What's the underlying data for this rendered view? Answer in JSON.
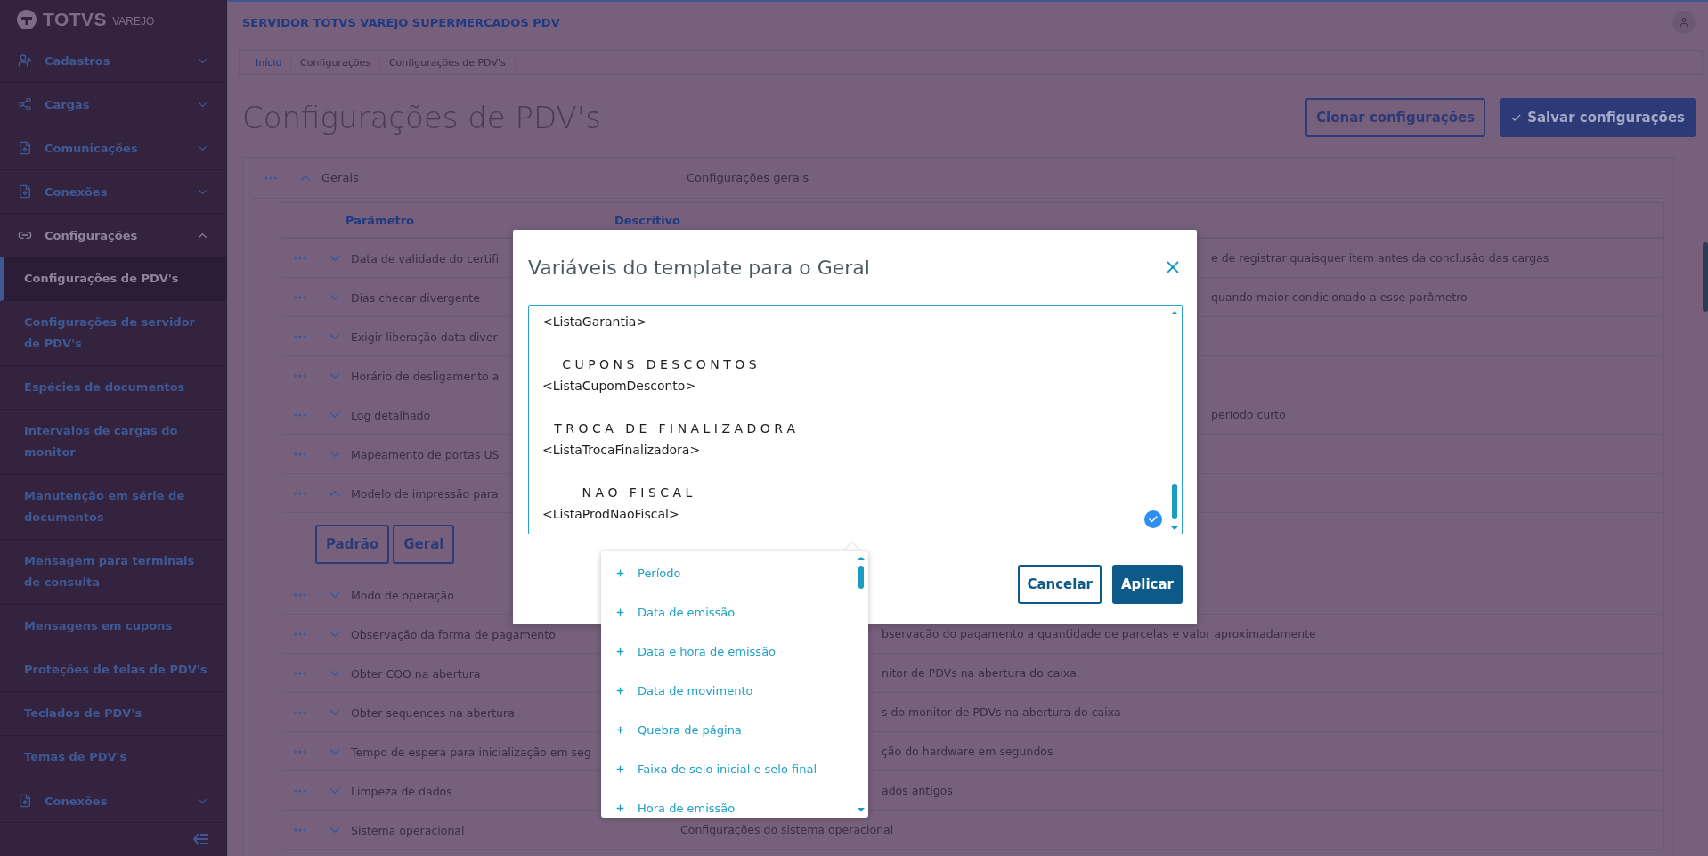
{
  "app": {
    "logo": "TOTVS",
    "logo_sub": "VAREJO",
    "server_title": "SERVIDOR TOTVS VAREJO SUPERMERCADOS PDV"
  },
  "sidebar": {
    "items": [
      {
        "label": "Cadastros",
        "kind": "group",
        "expanded": false
      },
      {
        "label": "Cargas",
        "kind": "group",
        "expanded": false
      },
      {
        "label": "Comunicações",
        "kind": "group",
        "expanded": false
      },
      {
        "label": "Conexões",
        "kind": "group",
        "expanded": false
      },
      {
        "label": "Configurações",
        "kind": "group",
        "expanded": true
      },
      {
        "label": "Configurações de PDV's",
        "kind": "link",
        "selected": true
      },
      {
        "label": "Configurações de servidor de PDV's",
        "kind": "link",
        "selected": false
      },
      {
        "label": "Espécies de documentos",
        "kind": "link",
        "selected": false
      },
      {
        "label": "Intervalos de cargas do monitor",
        "kind": "link",
        "selected": false
      },
      {
        "label": "Manutenção em série de documentos",
        "kind": "link",
        "selected": false
      },
      {
        "label": "Mensagem para terminais de consulta",
        "kind": "link",
        "selected": false
      },
      {
        "label": "Mensagens em cupons",
        "kind": "link",
        "selected": false
      },
      {
        "label": "Proteções de telas de PDV's",
        "kind": "link",
        "selected": false
      },
      {
        "label": "Teclados de PDV's",
        "kind": "link",
        "selected": false
      },
      {
        "label": "Temas de PDV's",
        "kind": "link",
        "selected": false
      },
      {
        "label": "Conexões",
        "kind": "group",
        "expanded": false
      }
    ]
  },
  "breadcrumb": [
    {
      "label": "Início",
      "kind": "link"
    },
    {
      "label": "Configurações",
      "kind": "text"
    },
    {
      "label": "Configurações de PDV's",
      "kind": "text"
    }
  ],
  "page_title": "Configurações de PDV's",
  "actions": [
    {
      "label": "Clonar configurações",
      "kind": "outline"
    },
    {
      "label": "Salvar configurações",
      "kind": "primary"
    }
  ],
  "section": {
    "label": "Gerais",
    "description": "Configurações gerais",
    "expanded": true
  },
  "table": {
    "columns": [
      "Parâmetro",
      "Descritivo"
    ],
    "rows": [
      {
        "parameter": "Data de validade do certifi",
        "description": {
          "text": "e de registrar quaisquer item antes da conclusão das cargas",
          "kind": "after_dialog"
        },
        "expanded": false
      },
      {
        "parameter": "Dias checar divergente",
        "description": {
          "text": "quando maior condicionado a esse parâmetro",
          "kind": "after_dialog"
        },
        "expanded": false
      },
      {
        "parameter": "Exigir liberação data diver",
        "expanded": false
      },
      {
        "parameter": "Horário de desligamento a",
        "expanded": false
      },
      {
        "parameter": "Log detalhado",
        "description": {
          "text": "período curto",
          "kind": "after_dialog"
        },
        "expanded": false
      },
      {
        "parameter": "Mapeamento de portas US",
        "expanded": false
      },
      {
        "parameter": "Modelo de impressão para",
        "expanded": true,
        "templates": [
          "Padrão",
          "Geral"
        ]
      },
      {
        "parameter": "Modo de operação",
        "expanded": false
      },
      {
        "parameter": "Observação da forma de pagamento",
        "description": {
          "text": "bservação do pagamento a quantidade de parcelas e valor aproximadamente",
          "kind": "after_menu"
        },
        "expanded": false
      },
      {
        "parameter": "Obter COO na abertura",
        "description": {
          "text": "nitor de PDVs na abertura do caixa.",
          "kind": "after_menu"
        },
        "expanded": false
      },
      {
        "parameter": "Obter sequences na abertura",
        "description": {
          "text": "s do monitor de PDVs na abertura do caixa",
          "kind": "after_menu"
        },
        "expanded": false
      },
      {
        "parameter": "Tempo de espera para inicialização em seg",
        "description": {
          "text": "ção do hardware em segundos",
          "kind": "after_menu"
        },
        "expanded": false
      },
      {
        "parameter": "Limpeza de dados",
        "description": {
          "text": "ados antigos",
          "kind": "after_menu"
        },
        "expanded": false
      },
      {
        "parameter": "Sistema operacional",
        "description": {
          "text": "Configurações do sistema operacional",
          "kind": "full"
        },
        "expanded": false
      }
    ]
  },
  "dialog": {
    "title": "Variáveis do template para o Geral",
    "template_value": "<ListaGarantia>\n\n     C U P O N S   D E S C O N T O S\n<ListaCupomDesconto>\n\n   T R O C A   D E   F I N A L I Z A D O R A\n<ListaTrocaFinalizadora>\n\n          N A O   F I S C A L\n<ListaProdNaoFiscal>",
    "buttons": [
      {
        "label": "Cancelar",
        "kind": "outline"
      },
      {
        "label": "Aplicar",
        "kind": "primary"
      }
    ],
    "variables": [
      "Período",
      "Data de emissão",
      "Data e hora de emissão",
      "Data de movimento",
      "Quebra de página",
      "Faixa de selo inicial e selo final",
      "Hora de emissão"
    ]
  }
}
